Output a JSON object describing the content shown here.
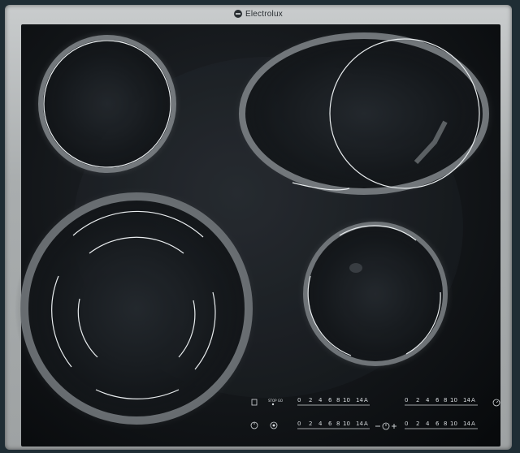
{
  "brand": {
    "name": "Electrolux"
  },
  "cooktop": {
    "zones": [
      {
        "id": "top-left"
      },
      {
        "id": "top-right-dual"
      },
      {
        "id": "bottom-left-triple"
      },
      {
        "id": "bottom-right"
      }
    ]
  },
  "controls": {
    "stop_go_label": "STOP GO",
    "scale": [
      "0",
      "2",
      "4",
      "6",
      "8",
      "10",
      "14",
      "A"
    ],
    "lock_icon": "lock-icon",
    "power_icon": "power-icon",
    "timer_icon": "timer-icon",
    "minus_icon": "minus-icon",
    "plus_icon": "plus-icon"
  },
  "colors": {
    "glass": "#121518",
    "frame": "#a9adae",
    "markings": "#d9dde0"
  }
}
